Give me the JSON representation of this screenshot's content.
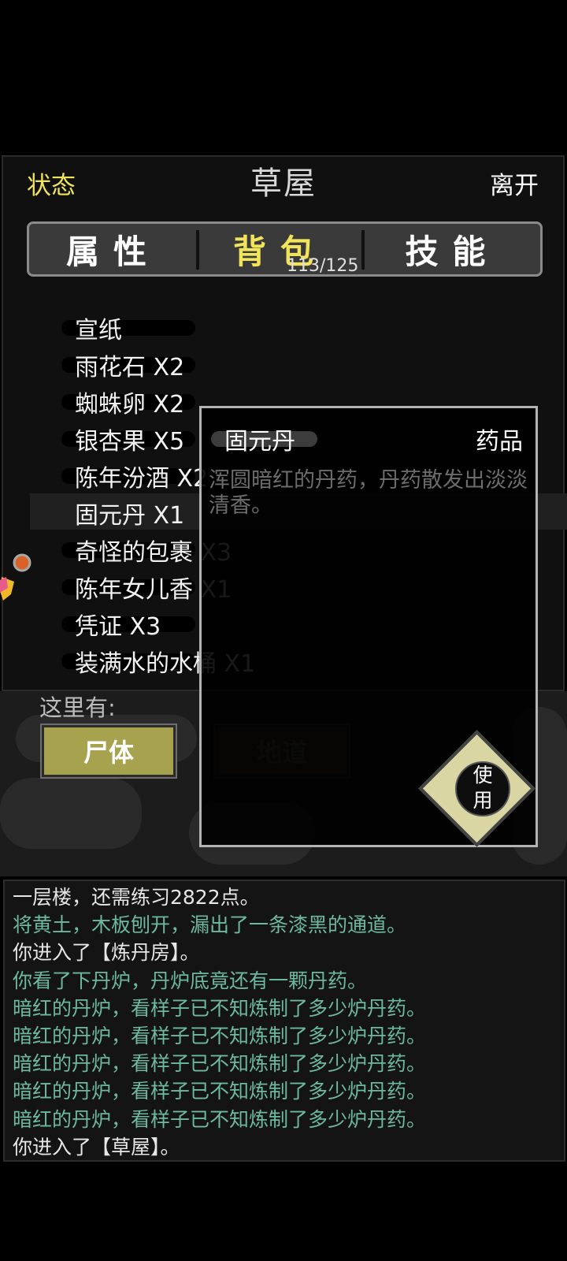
{
  "header": {
    "status_label": "状态",
    "title": "草屋",
    "leave_label": "离开"
  },
  "tabs": [
    {
      "label": "属性"
    },
    {
      "label": "背包",
      "count": "113/125"
    },
    {
      "label": "技能"
    }
  ],
  "inventory": [
    "宣纸",
    "雨花石 X2",
    "蜘蛛卵 X2",
    "银杏果 X5",
    "陈年汾酒 X2",
    "固元丹 X1",
    "奇怪的包裹 X3",
    "陈年女儿香 X1",
    "凭证 X3",
    "装满水的水桶 X1"
  ],
  "scene": {
    "here_label": "这里有:",
    "buttons": [
      "尸体",
      "地道"
    ]
  },
  "item_popup": {
    "name": "固元丹",
    "category": "药品",
    "description": "浑圆暗红的丹药，丹药散发出淡淡清香。",
    "use_label_top": "使",
    "use_label_bottom": "用"
  },
  "log": {
    "lines": [
      {
        "text": "一层楼，还需练习2822点。",
        "color": "#e6e6e6"
      },
      {
        "text": "将黄土，木板刨开，漏出了一条漆黑的通道。",
        "color": "#6db8a0"
      },
      {
        "text": "你进入了【炼丹房】。",
        "color": "#e6e6e6"
      },
      {
        "text": "你看了下丹炉，丹炉底竟还有一颗丹药。",
        "color": "#6db8a0"
      },
      {
        "text": "暗红的丹炉，看样子已不知炼制了多少炉丹药。",
        "color": "#6db8a0"
      },
      {
        "text": "暗红的丹炉，看样子已不知炼制了多少炉丹药。",
        "color": "#6db8a0"
      },
      {
        "text": "暗红的丹炉，看样子已不知炼制了多少炉丹药。",
        "color": "#6db8a0"
      },
      {
        "text": "暗红的丹炉，看样子已不知炼制了多少炉丹药。",
        "color": "#6db8a0"
      },
      {
        "text": "暗红的丹炉，看样子已不知炼制了多少炉丹药。",
        "color": "#6db8a0"
      },
      {
        "text": "你进入了【草屋】。",
        "color": "#e6e6e6"
      }
    ]
  },
  "colors": {
    "accent_yellow": "#f2e45a",
    "log_green": "#6db8a0",
    "button_olive": "#a6a24e"
  }
}
